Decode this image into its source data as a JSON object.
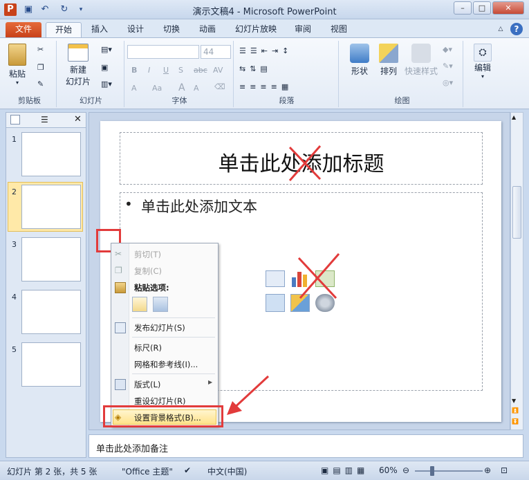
{
  "window": {
    "title": "演示文稿4 - Microsoft PowerPoint",
    "min": "–",
    "max": "□",
    "close": "✕"
  },
  "tabs": [
    "文件",
    "开始",
    "插入",
    "设计",
    "切换",
    "动画",
    "幻灯片放映",
    "审阅",
    "视图"
  ],
  "ribbon": {
    "clipboard": {
      "paste": "粘贴",
      "group": "剪贴板"
    },
    "slides": {
      "new_slide_line1": "新建",
      "new_slide_line2": "幻灯片",
      "group": "幻灯片"
    },
    "font": {
      "size": "44",
      "group": "字体",
      "bold": "B",
      "italic": "I",
      "underline": "U",
      "strike": "S",
      "abc": "abc",
      "av": "AV",
      "a_color": "A",
      "aa": "Aa",
      "grow": "A",
      "shrink": "A"
    },
    "paragraph": {
      "group": "段落"
    },
    "drawing": {
      "shapes": "形状",
      "arrange": "排列",
      "quick_styles": "快速样式",
      "group": "绘图"
    },
    "editing": {
      "label": "编辑"
    }
  },
  "leftpane": {
    "close": "✕",
    "thumbs": [
      "1",
      "2",
      "3",
      "4",
      "5"
    ]
  },
  "slide": {
    "title_placeholder": "单击此处添加标题",
    "bullet": "•",
    "body_placeholder": "单击此处添加文本"
  },
  "context_menu": {
    "cut": "剪切(T)",
    "copy": "复制(C)",
    "paste_options": "粘贴选项:",
    "publish": "发布幻灯片(S)",
    "ruler": "标尺(R)",
    "grid": "网格和参考线(I)...",
    "layout": "版式(L)",
    "reset": "重设幻灯片(R)",
    "format_bg": "设置背景格式(B)..."
  },
  "notes": {
    "placeholder": "单击此处添加备注"
  },
  "statusbar": {
    "slide_info": "幻灯片 第 2 张，共 5 张",
    "theme": "\"Office 主题\"",
    "language": "中文(中国)",
    "zoom": "60%"
  },
  "colors": {
    "accent_red": "#e23b3b",
    "file_tab": "#d1522a"
  }
}
